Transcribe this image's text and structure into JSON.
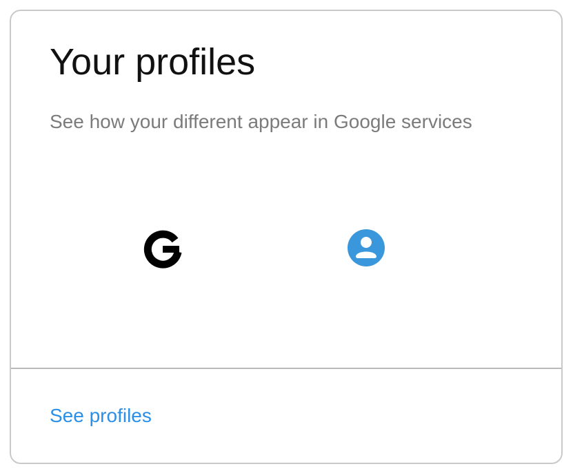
{
  "card": {
    "title": "Your profiles",
    "subtitle": "See how your different appear in Google services"
  },
  "icons": [
    {
      "name": "google-g-icon",
      "color": "#000000"
    },
    {
      "name": "account-circle-icon",
      "color": "#3a97db"
    }
  ],
  "footer": {
    "link_label": "See profiles",
    "link_color": "#2b8fe5"
  },
  "colors": {
    "border": "#c9c9c9",
    "divider": "#b9b9b9",
    "subtitle": "#7b7b7b",
    "title": "#111111"
  }
}
